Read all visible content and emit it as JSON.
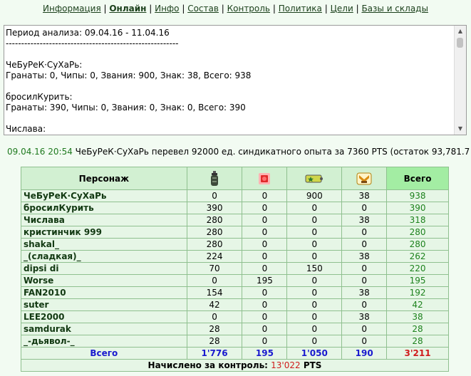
{
  "nav": [
    {
      "label": "Информация",
      "active": false
    },
    {
      "label": "Онлайн",
      "active": true
    },
    {
      "label": "Инфо",
      "active": false
    },
    {
      "label": "Состав",
      "active": false
    },
    {
      "label": "Контроль",
      "active": false
    },
    {
      "label": "Политика",
      "active": false
    },
    {
      "label": "Цели",
      "active": false
    },
    {
      "label": "Базы и склады",
      "active": false
    }
  ],
  "log": {
    "lines": [
      "Период анализа: 09.04.16 - 11.04.16",
      "--------------------------------------------------------",
      "",
      "ЧеБуРеК·СуХаРь:",
      "Гранаты: 0, Чипы: 0, Звания: 900, Знак: 38, Всего: 938",
      "",
      "бросилКурить:",
      "Гранаты: 390, Чипы: 0, Звания: 0, Знак: 0, Всего: 390",
      "",
      "Числава:"
    ]
  },
  "message": {
    "timestamp": "09.04.16 20:54",
    "text": "ЧеБуРеК·СуХаРь перевел 92000 ед. синдикатного опыта за 7360 PTS (остаток 93,781.7 PTS)"
  },
  "table": {
    "header_name": "Персонаж",
    "header_icons": [
      "grenade-icon",
      "chip-icon",
      "rank-icon",
      "badge-icon"
    ],
    "header_total": "Всего",
    "rows": [
      {
        "name": "ЧеБуРеК·СуХаРь",
        "v1": "0",
        "v2": "0",
        "v3": "900",
        "v4": "38",
        "total": "938"
      },
      {
        "name": "бросилКурить",
        "v1": "390",
        "v2": "0",
        "v3": "0",
        "v4": "0",
        "total": "390"
      },
      {
        "name": "Числава",
        "v1": "280",
        "v2": "0",
        "v3": "0",
        "v4": "38",
        "total": "318"
      },
      {
        "name": "кристинчик 999",
        "v1": "280",
        "v2": "0",
        "v3": "0",
        "v4": "0",
        "total": "280"
      },
      {
        "name": "shakal_",
        "v1": "280",
        "v2": "0",
        "v3": "0",
        "v4": "0",
        "total": "280"
      },
      {
        "name": "_(сладкая)_",
        "v1": "224",
        "v2": "0",
        "v3": "0",
        "v4": "38",
        "total": "262"
      },
      {
        "name": "dipsi di",
        "v1": "70",
        "v2": "0",
        "v3": "150",
        "v4": "0",
        "total": "220"
      },
      {
        "name": "Worse",
        "v1": "0",
        "v2": "195",
        "v3": "0",
        "v4": "0",
        "total": "195"
      },
      {
        "name": "FAN2010",
        "v1": "154",
        "v2": "0",
        "v3": "0",
        "v4": "38",
        "total": "192"
      },
      {
        "name": "suter",
        "v1": "42",
        "v2": "0",
        "v3": "0",
        "v4": "0",
        "total": "42"
      },
      {
        "name": "LEE2000",
        "v1": "0",
        "v2": "0",
        "v3": "0",
        "v4": "38",
        "total": "38"
      },
      {
        "name": "samdurak",
        "v1": "28",
        "v2": "0",
        "v3": "0",
        "v4": "0",
        "total": "28"
      },
      {
        "name": "_-дьявол-_",
        "v1": "28",
        "v2": "0",
        "v3": "0",
        "v4": "0",
        "total": "28"
      }
    ],
    "sum": {
      "label": "Всего",
      "v1": "1'776",
      "v2": "195",
      "v3": "1'050",
      "v4": "190",
      "total": "3'211"
    },
    "footer": {
      "label": "Начислено за контроль:",
      "amount": "13'022",
      "unit": "PTS"
    }
  }
}
